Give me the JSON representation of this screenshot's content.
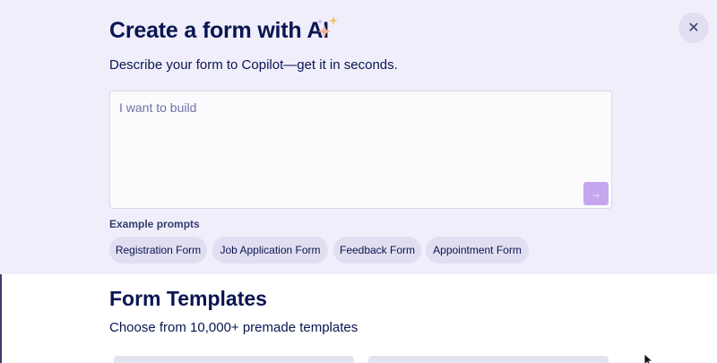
{
  "modal": {
    "title": "Create a form with AI",
    "subtitle": "Describe your form to Copilot—get it in seconds.",
    "close_icon": "close-icon",
    "sparkle_icon": "sparkles-icon"
  },
  "prompt": {
    "placeholder": "I want to build",
    "value": "",
    "send_icon": "arrow-right-icon",
    "send_glyph": "→"
  },
  "examples": {
    "label": "Example prompts",
    "chips": [
      "Registration Form",
      "Job Application Form",
      "Feedback Form",
      "Appointment Form"
    ]
  },
  "templates": {
    "title": "Form Templates",
    "subtitle": "Choose from 10,000+ premade templates"
  },
  "colors": {
    "accent": "#c6a6ee",
    "panel_background": "#f0eefb",
    "text_primary": "#0a1551",
    "chip_background": "#e0def0"
  }
}
